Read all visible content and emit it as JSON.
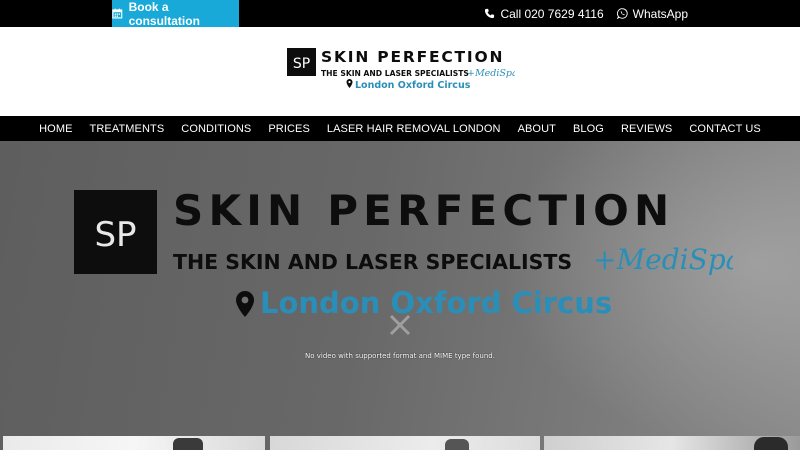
{
  "topbar": {
    "book_label": "Book a consultation",
    "phone_label": "Call 020 7629 4116",
    "whatsapp_label": "WhatsApp"
  },
  "brand": {
    "initials": "SP",
    "name": "SKIN PERFECTION",
    "tagline": "THE SKIN AND LASER SPECIALISTS",
    "medispa": "+MediSpa",
    "location": "London Oxford Circus"
  },
  "nav": {
    "items": [
      "HOME",
      "TREATMENTS",
      "CONDITIONS",
      "PRICES",
      "LASER HAIR REMOVAL LONDON",
      "ABOUT",
      "BLOG",
      "REVIEWS",
      "CONTACT US"
    ]
  },
  "hero": {
    "video_message": "No video with supported format and MIME type found."
  },
  "colors": {
    "accent": "#18a9d8",
    "bar": "#000000",
    "hero_text": "#0d0d0d",
    "location_blue": "#2a8fb8"
  },
  "icons": {
    "book": "calendar-icon",
    "phone": "phone-icon",
    "whatsapp": "whatsapp-icon",
    "location": "map-pin-icon",
    "close": "close-icon"
  }
}
